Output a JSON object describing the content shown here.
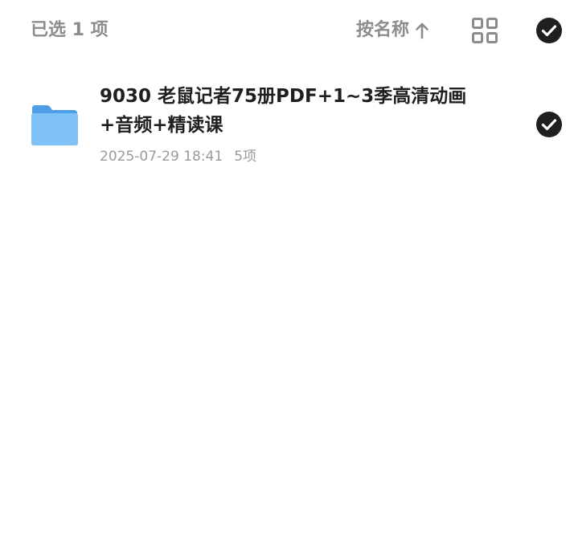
{
  "toolbar": {
    "selected_count": "已选 1 项",
    "sort_label": "按名称",
    "sort_direction": "ascending",
    "sort_arrow_icon": "arrow-up-icon",
    "grid_icon": "grid-view-icon",
    "select_all_icon": "check-circle-icon",
    "text_color": "#8c8c8c"
  },
  "files": [
    {
      "name": "9030 老鼠记者75册PDF+1~3季高清动画+音频+精读课",
      "date": "2025-07-29 18:41",
      "count": "5项",
      "icon": "folder-icon",
      "selected": true
    }
  ],
  "colors": {
    "check_fill": "#1f1f1f",
    "folder_blue": "#5aaef0",
    "name_text": "#1f1f1f",
    "meta_text": "#9a9a9a"
  }
}
